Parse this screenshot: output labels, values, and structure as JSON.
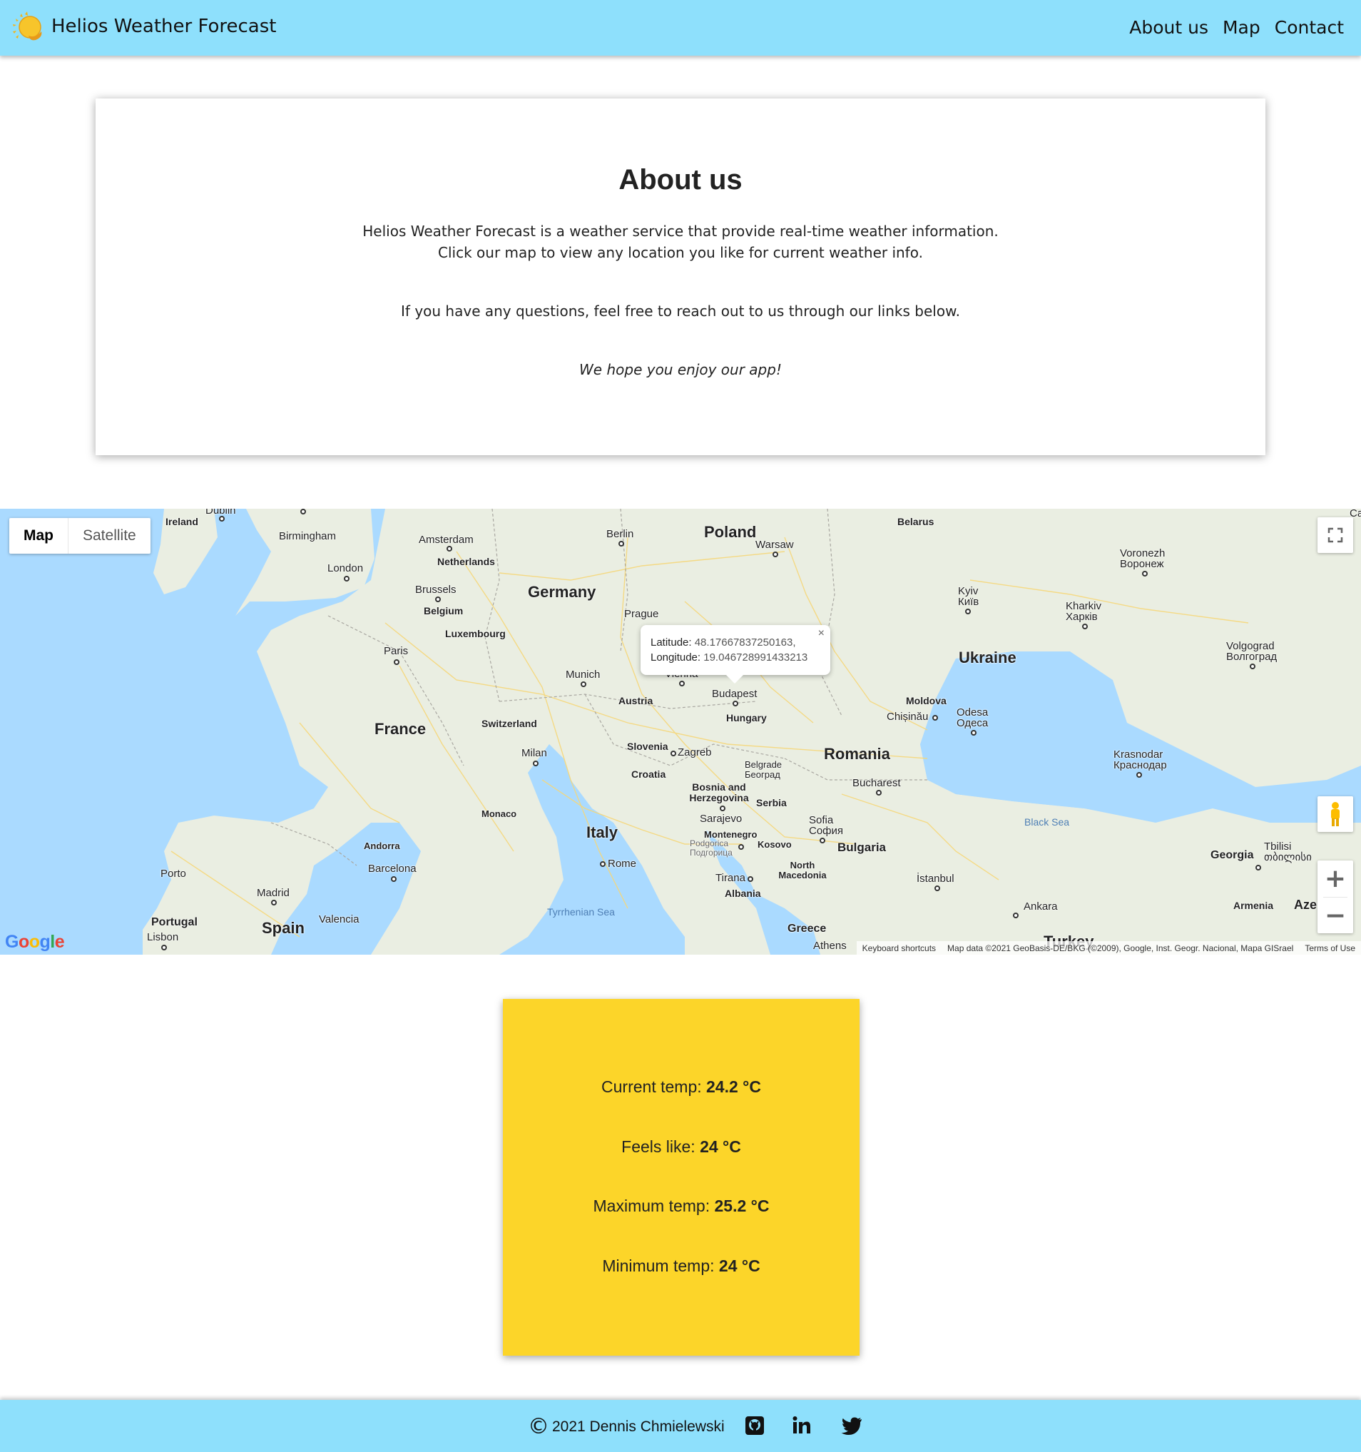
{
  "header": {
    "title": "Helios Weather Forecast",
    "nav": [
      "About us",
      "Map",
      "Contact"
    ]
  },
  "about": {
    "heading": "About us",
    "line1": "Helios Weather Forecast is a weather service that provide real-time weather information.",
    "line2": "Click our map to view any location you like for current weather info.",
    "line3": "If you have any questions, feel free to reach out to us through our links below.",
    "line4": "We hope you enjoy our app!"
  },
  "map": {
    "type_map": "Map",
    "type_satellite": "Satellite",
    "infowindow": {
      "lat_label": "Latitude:",
      "lat_value": "48.17667837250163,",
      "lng_label": "Longitude:",
      "lng_value": "19.046728991433213",
      "close": "×"
    },
    "zoom_in": "+",
    "zoom_out": "−",
    "google": "Google",
    "attribution": {
      "shortcuts": "Keyboard shortcuts",
      "data": "Map data ©2021 GeoBasis-DE/BKG (©2009), Google, Inst. Geogr. Nacional, Mapa GISrael",
      "terms": "Terms of Use"
    },
    "countries": [
      "Ireland",
      "Poland",
      "Belarus",
      "Netherlands",
      "Germany",
      "Belgium",
      "Luxembourg",
      "Ukraine",
      "France",
      "Austria",
      "Switzerland",
      "Hungary",
      "Moldova",
      "Romania",
      "Slovenia",
      "Croatia",
      "Bosnia and Herzegovina",
      "Serbia",
      "Montenegro",
      "Kosovo",
      "Bulgaria",
      "Italy",
      "North Macedonia",
      "Albania",
      "Georgia",
      "Armenia",
      "Azer",
      "Portugal",
      "Spain",
      "Greece",
      "Turkey",
      "Monaco",
      "Andorra"
    ],
    "cities": [
      "Dublin",
      "Birmingham",
      "London",
      "Amsterdam",
      "Berlin",
      "Warsaw",
      "Brussels",
      "Prague",
      "Paris",
      "Munich",
      "Vienna",
      "Budapest",
      "Kyiv",
      "Київ",
      "Kharkiv",
      "Харків",
      "Voronezh",
      "Воронеж",
      "Volgograd",
      "Волгоград",
      "Chișinău",
      "Odesa",
      "Одеса",
      "Zagreb",
      "Milan",
      "Belgrade",
      "Београд",
      "Bucharest",
      "Sarajevo",
      "Podgorica",
      "Подгорица",
      "Sofia",
      "София",
      "Tirana",
      "İstanbul",
      "Ankara",
      "Krasnodar",
      "Краснодар",
      "Tbilisi",
      "თბილისი",
      "Porto",
      "Barcelona",
      "Madrid",
      "Valencia",
      "Lisbon",
      "Rome",
      "Athens",
      "Ca"
    ],
    "seas": [
      "Black Sea",
      "Tyrrhenian Sea"
    ]
  },
  "weather": {
    "current_label": "Current temp: ",
    "current_value": "24.2 °C",
    "feels_label": "Feels like: ",
    "feels_value": "24 °C",
    "max_label": "Maximum temp: ",
    "max_value": "25.2 °C",
    "min_label": "Minimum temp: ",
    "min_value": "24 °C"
  },
  "footer": {
    "copyright_symbol": "©",
    "copyright": "2021 Dennis Chmielewski",
    "icons": [
      "github-icon",
      "linkedin-icon",
      "twitter-icon"
    ]
  },
  "colors": {
    "header_bg": "#8ee0fc",
    "weather_card": "#fcd529",
    "sea": "#aadaff",
    "land": "#eaeee2"
  }
}
